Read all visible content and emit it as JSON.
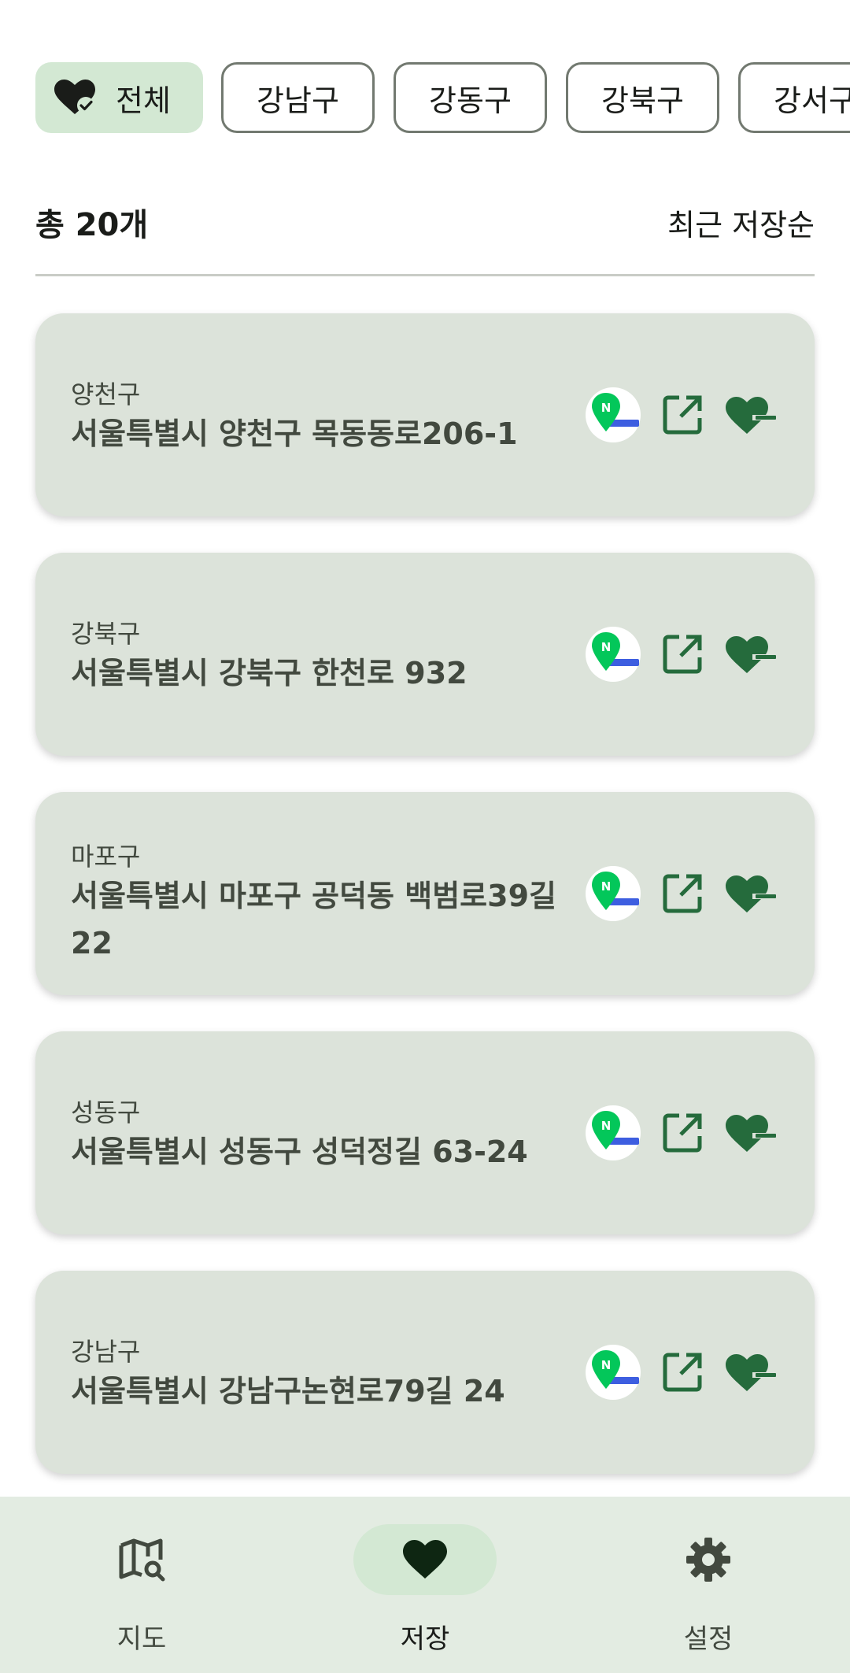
{
  "filters": {
    "chips": [
      {
        "label": "전체",
        "selected": true,
        "icon": "heart-check-icon"
      },
      {
        "label": "강남구",
        "selected": false
      },
      {
        "label": "강동구",
        "selected": false
      },
      {
        "label": "강북구",
        "selected": false
      },
      {
        "label": "강서구",
        "selected": false
      }
    ]
  },
  "summary": {
    "total": "총 20개",
    "sort": "최근 저장순"
  },
  "cards": [
    {
      "district": "양천구",
      "address": "서울특별시 양천구 목동동로206-1"
    },
    {
      "district": "강북구",
      "address": "서울특별시 강북구 한천로 932"
    },
    {
      "district": "마포구",
      "address": "서울특별시 마포구 공덕동 백범로39길 22"
    },
    {
      "district": "성동구",
      "address": "서울특별시 성동구 성덕정길 63-24"
    },
    {
      "district": "강남구",
      "address": "서울특별시 강남구논현로79길 24"
    }
  ],
  "card_actions": {
    "icons": [
      "naver-map-icon",
      "open-external-icon",
      "heart-minus-icon"
    ]
  },
  "nav": {
    "items": [
      {
        "label": "지도",
        "icon": "map-search-icon",
        "active": false
      },
      {
        "label": "저장",
        "icon": "heart-icon",
        "active": true
      },
      {
        "label": "설정",
        "icon": "gear-icon",
        "active": false
      }
    ]
  },
  "colors": {
    "accent_green": "#256b3c",
    "chip_selected_bg": "#d3e8d3",
    "card_bg": "#dce3da",
    "nav_bg": "#e3ece2",
    "naver_green": "#03c75a",
    "naver_blue": "#3d5ee0"
  }
}
